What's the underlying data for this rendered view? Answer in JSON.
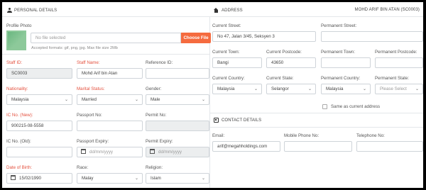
{
  "personal": {
    "section_title": "PERSONAL DETAILS",
    "profile_photo_label": "Profile Photo",
    "file_placeholder": "No file selected",
    "choose_file": "Choose File",
    "file_hint": "Accepted formats: gif, png, jpg. Max file size 2Mb",
    "staff_id_label": "Staff ID:",
    "staff_id": "SC0003",
    "staff_name_label": "Staff Name:",
    "staff_name": "Mohd Arif bin Atan",
    "reference_id_label": "Reference ID:",
    "reference_id": "",
    "nationality_label": "Nationality:",
    "nationality": "Malaysia",
    "marital_label": "Marital Status:",
    "marital": "Married",
    "gender_label": "Gender:",
    "gender": "Male",
    "ic_new_label": "IC No. (New):",
    "ic_new": "900215-08-5558",
    "passport_label": "Passport No:",
    "passport": "",
    "permit_label": "Permit No:",
    "permit": "",
    "ic_old_label": "IC No. (Old):",
    "ic_old": "",
    "passport_expiry_label": "Passport Expiry:",
    "passport_expiry": "dd/mm/yyyy",
    "permit_expiry_label": "Permit Expiry:",
    "permit_expiry": "dd/mm/yyyy",
    "dob_label": "Date of Birth:",
    "dob": "15/02/1990",
    "race_label": "Race:",
    "race": "Malay",
    "religion_label": "Religion:",
    "religion": "Islam"
  },
  "address": {
    "section_title": "ADDRESS",
    "header_name": "MOHD ARIF BIN ATAN (SC0003)",
    "current_street_label": "Current Street:",
    "current_street": "No 47, Jalan 3/45, Seksyen 3",
    "permanent_street_label": "Permanent Street:",
    "permanent_street": "",
    "current_town_label": "Current Town:",
    "current_town": "Bangi",
    "current_postcode_label": "Current Postcode:",
    "current_postcode": "43650",
    "permanent_town_label": "Permanent Town:",
    "permanent_town": "",
    "permanent_postcode_label": "Permanent Postcode:",
    "permanent_postcode": "",
    "current_country_label": "Current Country:",
    "current_country": "Malaysia",
    "current_state_label": "Current State:",
    "current_state": "Selangor",
    "permanent_country_label": "Permanent Country:",
    "permanent_country": "Malaysia",
    "permanent_state_label": "Permanent State:",
    "permanent_state": "Please Select",
    "same_as_current": "Same as current address"
  },
  "contact": {
    "section_title": "CONTACT DETAILS",
    "email_label": "Email:",
    "email": "arif@megahholdings.com",
    "mobile_label": "Mobile Phone No:",
    "mobile": "",
    "telephone_label": "Telephone No:",
    "telephone": ""
  },
  "icons": {
    "caret": "⌄"
  },
  "colors": {
    "accent": "#f56b3f",
    "required_label": "#e4513f",
    "readonly_bg": "#eceeef"
  }
}
